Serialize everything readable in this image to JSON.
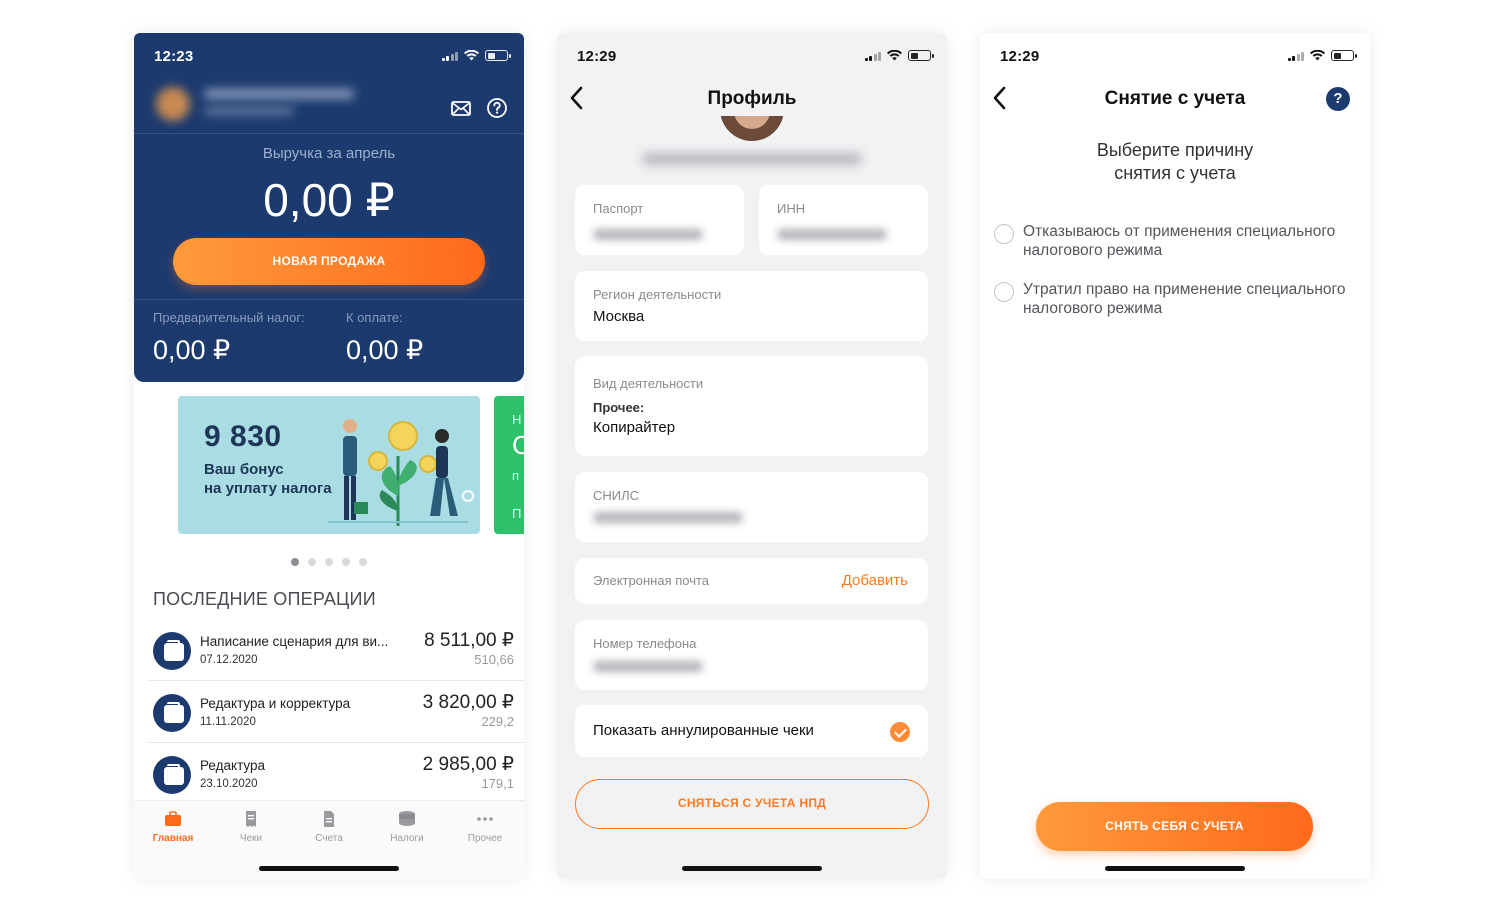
{
  "screen1": {
    "time": "12:23",
    "revenue_label": "Выручка за апрель",
    "revenue_amount": "0,00 ₽",
    "new_sale_label": "НОВАЯ ПРОДАЖА",
    "prelim_tax_label": "Предварительный налог:",
    "prelim_tax_amount": "0,00 ₽",
    "to_pay_label": "К оплате:",
    "to_pay_amount": "0,00 ₽",
    "promo": {
      "number": "9 830",
      "line1": "Ваш бонус",
      "line2": "на уплату налога"
    },
    "promo_next_glyphs": [
      "Н",
      "С",
      "п",
      "П"
    ],
    "section_title": "ПОСЛЕДНИЕ ОПЕРАЦИИ",
    "operations": [
      {
        "title": "Написание сценария для ви...",
        "date": "07.12.2020",
        "amount": "8 511,00 ₽",
        "tax": "510,66"
      },
      {
        "title": "Редактура и корректура",
        "date": "11.11.2020",
        "amount": "3 820,00 ₽",
        "tax": "229,2"
      },
      {
        "title": "Редактура",
        "date": "23.10.2020",
        "amount": "2 985,00 ₽",
        "tax": "179,1"
      }
    ],
    "tabs": [
      "Главная",
      "Чеки",
      "Счета",
      "Налоги",
      "Прочее"
    ]
  },
  "screen2": {
    "time": "12:29",
    "title": "Профиль",
    "passport_label": "Паспорт",
    "inn_label": "ИНН",
    "region_label": "Регион деятельности",
    "region_value": "Москва",
    "activity_label": "Вид деятельности",
    "activity_group": "Прочее:",
    "activity_value": "Копирайтер",
    "snils_label": "СНИЛС",
    "email_label": "Электронная почта",
    "email_add": "Добавить",
    "phone_label": "Номер телефона",
    "show_cancelled_label": "Показать аннулированные чеки",
    "deregister_button": "СНЯТЬСЯ С УЧЕТА НПД"
  },
  "screen3": {
    "time": "12:29",
    "title": "Снятие с учета",
    "help": "?",
    "prompt_line1": "Выберите причину",
    "prompt_line2": "снятия с учета",
    "reasons": [
      {
        "line1": "Отказываюсь от применения специального",
        "line2": "налогового режима"
      },
      {
        "line1": "Утратил право на применение специального",
        "line2": "налогового режима"
      }
    ],
    "submit_button": "СНЯТЬ СЕБЯ С УЧЕТА"
  },
  "colors": {
    "brand_blue": "#1c3a6e",
    "accent_orange": "#ff7a1f",
    "promo_teal": "#a9dde3",
    "promo_green": "#2ec16a"
  }
}
